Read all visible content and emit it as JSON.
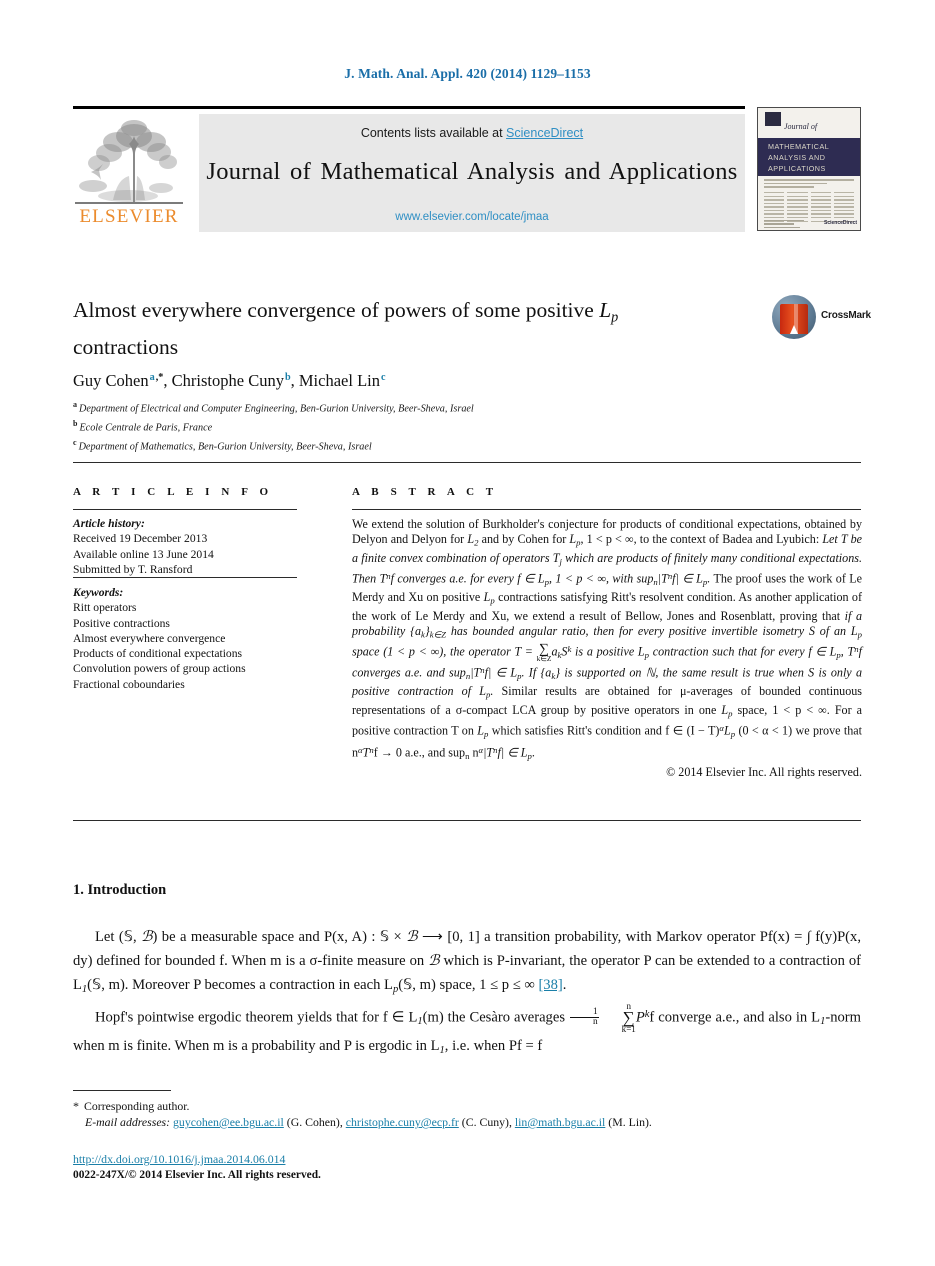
{
  "running_head": "J. Math. Anal. Appl. 420 (2014) 1129–1153",
  "masthead": {
    "contents_prefix": "Contents lists available at ",
    "sciencedirect": "ScienceDirect",
    "journal_title": "Journal of Mathematical Analysis and Applications",
    "journal_url": "www.elsevier.com/locate/jmaa",
    "publisher_logo_text": "ELSEVIER",
    "publisher_logo_icon": "elsevier-tree-icon",
    "accent_link_color": "#2f8fc4",
    "elsevier_orange": "#eb8b2d"
  },
  "cover_thumbnail": {
    "journal_of": "Journal of",
    "band_text": "MATHEMATICAL ANALYSIS AND APPLICATIONS",
    "sciencedirect_badge": "ScienceDirect",
    "band_color": "#2e2c52"
  },
  "title": {
    "line1_a": "Almost everywhere convergence of powers of some positive ",
    "line1_math_base": "L",
    "line1_math_sub": "p",
    "line2": "contractions"
  },
  "crossmark": {
    "label": "CrossMark",
    "icon": "crossmark-book-icon"
  },
  "authors": {
    "a1_name": "Guy Cohen",
    "a1_marks": "a",
    "a1_star": ",*",
    "sep1": ", ",
    "a2_name": "Christophe Cuny",
    "a2_marks": "b",
    "sep2": ", ",
    "a3_name": "Michael Lin",
    "a3_marks": "c"
  },
  "affiliations": [
    {
      "mark": "a",
      "text": "Department of Electrical and Computer Engineering, Ben-Gurion University, Beer-Sheva, Israel"
    },
    {
      "mark": "b",
      "text": "Ecole Centrale de Paris, France"
    },
    {
      "mark": "c",
      "text": "Department of Mathematics, Ben-Gurion University, Beer-Sheva, Israel"
    }
  ],
  "section_headers": {
    "article_info": "A R T I C L E   I N F O",
    "abstract": "A B S T R A C T"
  },
  "article_history": {
    "label": "Article history:",
    "received": "Received 19 December 2013",
    "available_online": "Available online 13 June 2014",
    "submitted_by": "Submitted by T. Ransford"
  },
  "keywords": {
    "label": "Keywords:",
    "items": [
      "Ritt operators",
      "Positive contractions",
      "Almost everywhere convergence",
      "Products of conditional expectations",
      "Convolution powers of group actions",
      "Fractional coboundaries"
    ]
  },
  "abstract": {
    "p1_s1": "We extend the solution of Burkholder's conjecture for products of conditional expectations, obtained by Delyon and Delyon for ",
    "p1_L2": "L",
    "p1_L2_sub": "2",
    "p1_s2": " and by Cohen for ",
    "p1_Lp": "L",
    "p1_Lp_sub": "p",
    "p1_s3": ", 1 < p < ∞, to the context of Badea and Lyubich: ",
    "p1_italic1": "Let T be a finite convex combination of operators T",
    "p1_italic1_sub": "j",
    "p1_italic2": " which are products of finitely many conditional expectations. Then T",
    "p1_italic2_sup": "n",
    "p1_italic3": "f converges a.e. for every f ∈ L",
    "p1_italic3_sub": "p",
    "p1_italic4": ", 1 < p < ∞, with sup",
    "p1_italic4_sub": "n",
    "p1_italic5": "|T",
    "p1_italic5_sup": "n",
    "p1_italic6": "f| ∈ L",
    "p1_italic6_sub": "p",
    "p1_italic7": ".",
    "p1_s4": " The proof uses the work of Le Merdy and Xu on positive ",
    "p1_Lp2": "L",
    "p1_Lp2_sub": "p",
    "p1_s5": " contractions satisfying Ritt's resolvent condition. As another application of the work of Le Merdy and Xu, we extend a result of Bellow, Jones and Rosenblatt, proving that ",
    "p1_italic8": "if a probability {a",
    "p1_italic8_sub": "k",
    "p1_italic9": "}",
    "p1_italic9_sub": "k∈Z",
    "p1_italic10": " has bounded angular ratio, then for every positive invertible isometry S of an L",
    "p1_italic10_sub": "p",
    "p1_italic11": " space (1 < p < ∞), the operator T = ",
    "p1_sum_top": "",
    "p1_sum_bot": "k∈Z",
    "p1_italic12": "a",
    "p1_italic12_sub": "k",
    "p1_italic13": "S",
    "p1_italic13_sup": "k",
    "p1_italic14": " is a positive L",
    "p1_italic14_sub": "p",
    "p1_italic15": " contraction such that for every f ∈ L",
    "p1_italic15_sub": "p",
    "p1_italic16": ", T",
    "p1_italic16_sup": "n",
    "p1_italic17": "f converges a.e. and sup",
    "p1_italic17_sub": "n",
    "p1_italic18": "|T",
    "p1_italic18_sup": "n",
    "p1_italic19": "f| ∈ L",
    "p1_italic19_sub": "p",
    "p1_italic20": ". If {a",
    "p1_italic20_sub": "k",
    "p1_italic21": "} is supported on ℕ, the same result is true when S is only a positive contraction of L",
    "p1_italic21_sub": "p",
    "p1_italic22": ".",
    "p1_s6": " Similar results are obtained for μ-averages of bounded continuous representations of a σ-compact LCA group by positive operators in one ",
    "p1_Lp3": "L",
    "p1_Lp3_sub": "p",
    "p1_s7": " space, 1 < p < ∞. For a positive contraction T on ",
    "p1_Lp4": "L",
    "p1_Lp4_sub": "p",
    "p1_s8": " which satisfies Ritt's condition and f ∈ (I − T)",
    "p1_s8_sup": "α",
    "p1_Lp5": "L",
    "p1_Lp5_sub": "p",
    "p1_s9": " (0 < α < 1) we prove that n",
    "p1_s9_sup": "α",
    "p1_s10": "T",
    "p1_s10_sup": "n",
    "p1_s11": "f → 0 a.e., and sup",
    "p1_s11_sub": "n",
    "p1_s12": " n",
    "p1_s12_sup": "α",
    "p1_s13": "|T",
    "p1_s13_sup": "n",
    "p1_s14": "f| ∈ L",
    "p1_s14_sub": "p",
    "p1_s15": ".",
    "copyright": "© 2014 Elsevier Inc. All rights reserved."
  },
  "body": {
    "section_number_title": "1.  Introduction",
    "p1_a": "Let (𝕊, ",
    "p1_B1": "ℬ",
    "p1_b": ") be a measurable space and P(x, A) : 𝕊 × ",
    "p1_B2": "ℬ",
    "p1_c": " ⟶ [0, 1] a transition probability, with Markov operator Pf(x) = ∫ f(y)P(x, dy) defined for bounded f. When m is a σ-finite measure on ",
    "p1_B3": "ℬ",
    "p1_d": " which is P-invariant, the operator P can be extended to a contraction of L",
    "p1_d_sub": "1",
    "p1_e": "(𝕊, m). Moreover P becomes a contraction in each L",
    "p1_e_sub": "p",
    "p1_f": "(𝕊, m) space, 1 ≤ p ≤ ∞ ",
    "p1_ref": "[38]",
    "p1_g": ".",
    "p2_a": "Hopf's pointwise ergodic theorem yields that for f ∈ L",
    "p2_a_sub": "1",
    "p2_b": "(m) the Cesàro averages ",
    "p2_frac_num": "1",
    "p2_frac_den": "n",
    "p2_sum_top": "n",
    "p2_sum_bot": "k=1",
    "p2_c": "P",
    "p2_c_sup": "k",
    "p2_d": "f converge a.e., and also in L",
    "p2_d_sub": "1",
    "p2_e": "-norm when m is finite. When m is a probability and P is ergodic in L",
    "p2_e_sub": "1",
    "p2_f": ", i.e. when Pf = f"
  },
  "footnotes": {
    "star": "*",
    "corresponding": "Corresponding author.",
    "email_label": "E-mail addresses:",
    "emails": [
      {
        "address": "guycohen@ee.bgu.ac.il",
        "person": "(G. Cohen),"
      },
      {
        "address": "christophe.cuny@ecp.fr",
        "person": "(C. Cuny),"
      },
      {
        "address": "lin@math.bgu.ac.il",
        "person": "(M. Lin)."
      }
    ]
  },
  "doi_block": {
    "doi_url": "http://dx.doi.org/10.1016/j.jmaa.2014.06.014",
    "issn_line": "0022-247X/© 2014 Elsevier Inc. All rights reserved."
  }
}
